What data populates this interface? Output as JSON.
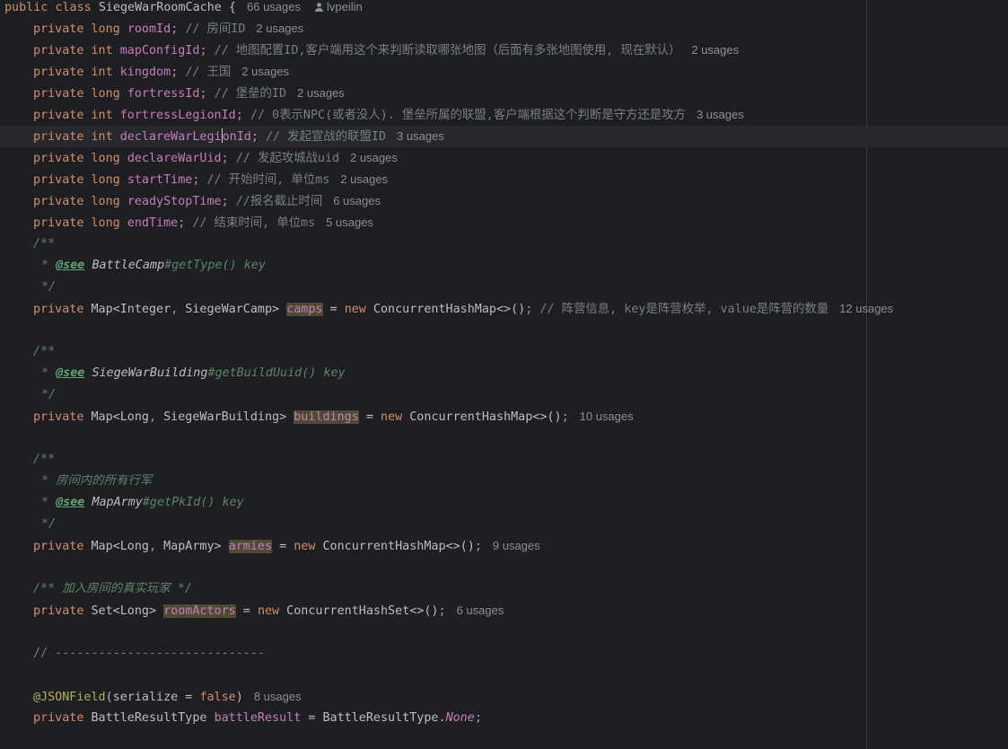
{
  "class_decl": {
    "public": "public",
    "class": "class",
    "name": "SiegeWarRoomCache",
    "brace": " {",
    "usages": "66 usages",
    "author": "lvpeilin"
  },
  "fields": [
    {
      "mod": "private",
      "type": "long",
      "name": "roomId",
      "comment": "// 房间ID",
      "usages": "2 usages"
    },
    {
      "mod": "private",
      "type": "int",
      "name": "mapConfigId",
      "comment": "// 地图配置ID,客户端用这个来判断读取哪张地图（后面有多张地图使用, 现在默认）",
      "usages": "2 usages"
    },
    {
      "mod": "private",
      "type": "int",
      "name": "kingdom",
      "comment": "// 王国",
      "usages": "2 usages"
    },
    {
      "mod": "private",
      "type": "long",
      "name": "fortressId",
      "comment": "// 堡垒的ID",
      "usages": "2 usages"
    },
    {
      "mod": "private",
      "type": "int",
      "name": "fortressLegionId",
      "comment": "// 0表示NPC(或者没人). 堡垒所属的联盟,客户端根据这个判断是守方还是攻方",
      "usages": "3 usages"
    },
    {
      "mod": "private",
      "type": "int",
      "name": "declareWarLegionId",
      "name_pre": "declareWarLegi",
      "name_post": "onId",
      "comment": "// 发起宣战的联盟ID",
      "usages": "3 usages"
    },
    {
      "mod": "private",
      "type": "long",
      "name": "declareWarUid",
      "comment": "// 发起攻城战uid",
      "usages": "2 usages"
    },
    {
      "mod": "private",
      "type": "long",
      "name": "startTime",
      "comment": "// 开始时间, 单位ms",
      "usages": "2 usages"
    },
    {
      "mod": "private",
      "type": "long",
      "name": "readyStopTime",
      "comment": "//报名截止时间",
      "usages": "6 usages"
    },
    {
      "mod": "private",
      "type": "long",
      "name": "endTime",
      "comment": "// 结束时间, 单位ms",
      "usages": "5 usages"
    }
  ],
  "doc_open": "/**",
  "doc_close": "*/",
  "doc_star": "*",
  "see_tag": "@see",
  "camps": {
    "see_ref": "BattleCamp",
    "see_member": "#getType() key",
    "mod": "private",
    "type_pre": "Map<Integer",
    "comma": ",",
    "type_post": " SiegeWarCamp>",
    "name": "camps",
    "eq": " = ",
    "new": "new",
    "init": " ConcurrentHashMap<>()",
    "semi": ";",
    "comment": "// 阵营信息, key是阵营枚举, value是阵营的数量",
    "usages": "12 usages"
  },
  "buildings": {
    "see_ref": "SiegeWarBuilding",
    "see_member": "#getBuildUuid() key",
    "mod": "private",
    "type_pre": "Map<Long",
    "comma": ",",
    "type_post": " SiegeWarBuilding>",
    "name": "buildings",
    "eq": " = ",
    "new": "new",
    "init": " ConcurrentHashMap<>()",
    "semi": ";",
    "usages": "10 usages"
  },
  "armies": {
    "desc": "房间内的所有行军",
    "see_ref": "MapArmy",
    "see_member": "#getPkId() key",
    "mod": "private",
    "type_pre": "Map<Long",
    "comma": ",",
    "type_post": " MapArmy>",
    "name": "armies",
    "eq": " = ",
    "new": "new",
    "init": " ConcurrentHashMap<>()",
    "semi": ";",
    "usages": "9 usages"
  },
  "room_actors": {
    "doc": "/** 加入房间的真实玩家 */",
    "mod": "private",
    "type": "Set<Long>",
    "name": "roomActors",
    "eq": " = ",
    "new": "new",
    "init": " ConcurrentHashSet<>()",
    "semi": ";",
    "usages": "6 usages"
  },
  "separator": "// -----------------------------",
  "json_field": {
    "annotation": "@JSONField",
    "args_pre": "(serialize = ",
    "args_val": "false",
    "args_post": ")",
    "usages": "8 usages"
  },
  "battle_result": {
    "mod": "private",
    "type": "BattleResultType",
    "name": "battleResult",
    "eq": " = ",
    "cls": "BattleResultType",
    "dot": ".",
    "value": "None",
    "semi": ";"
  }
}
